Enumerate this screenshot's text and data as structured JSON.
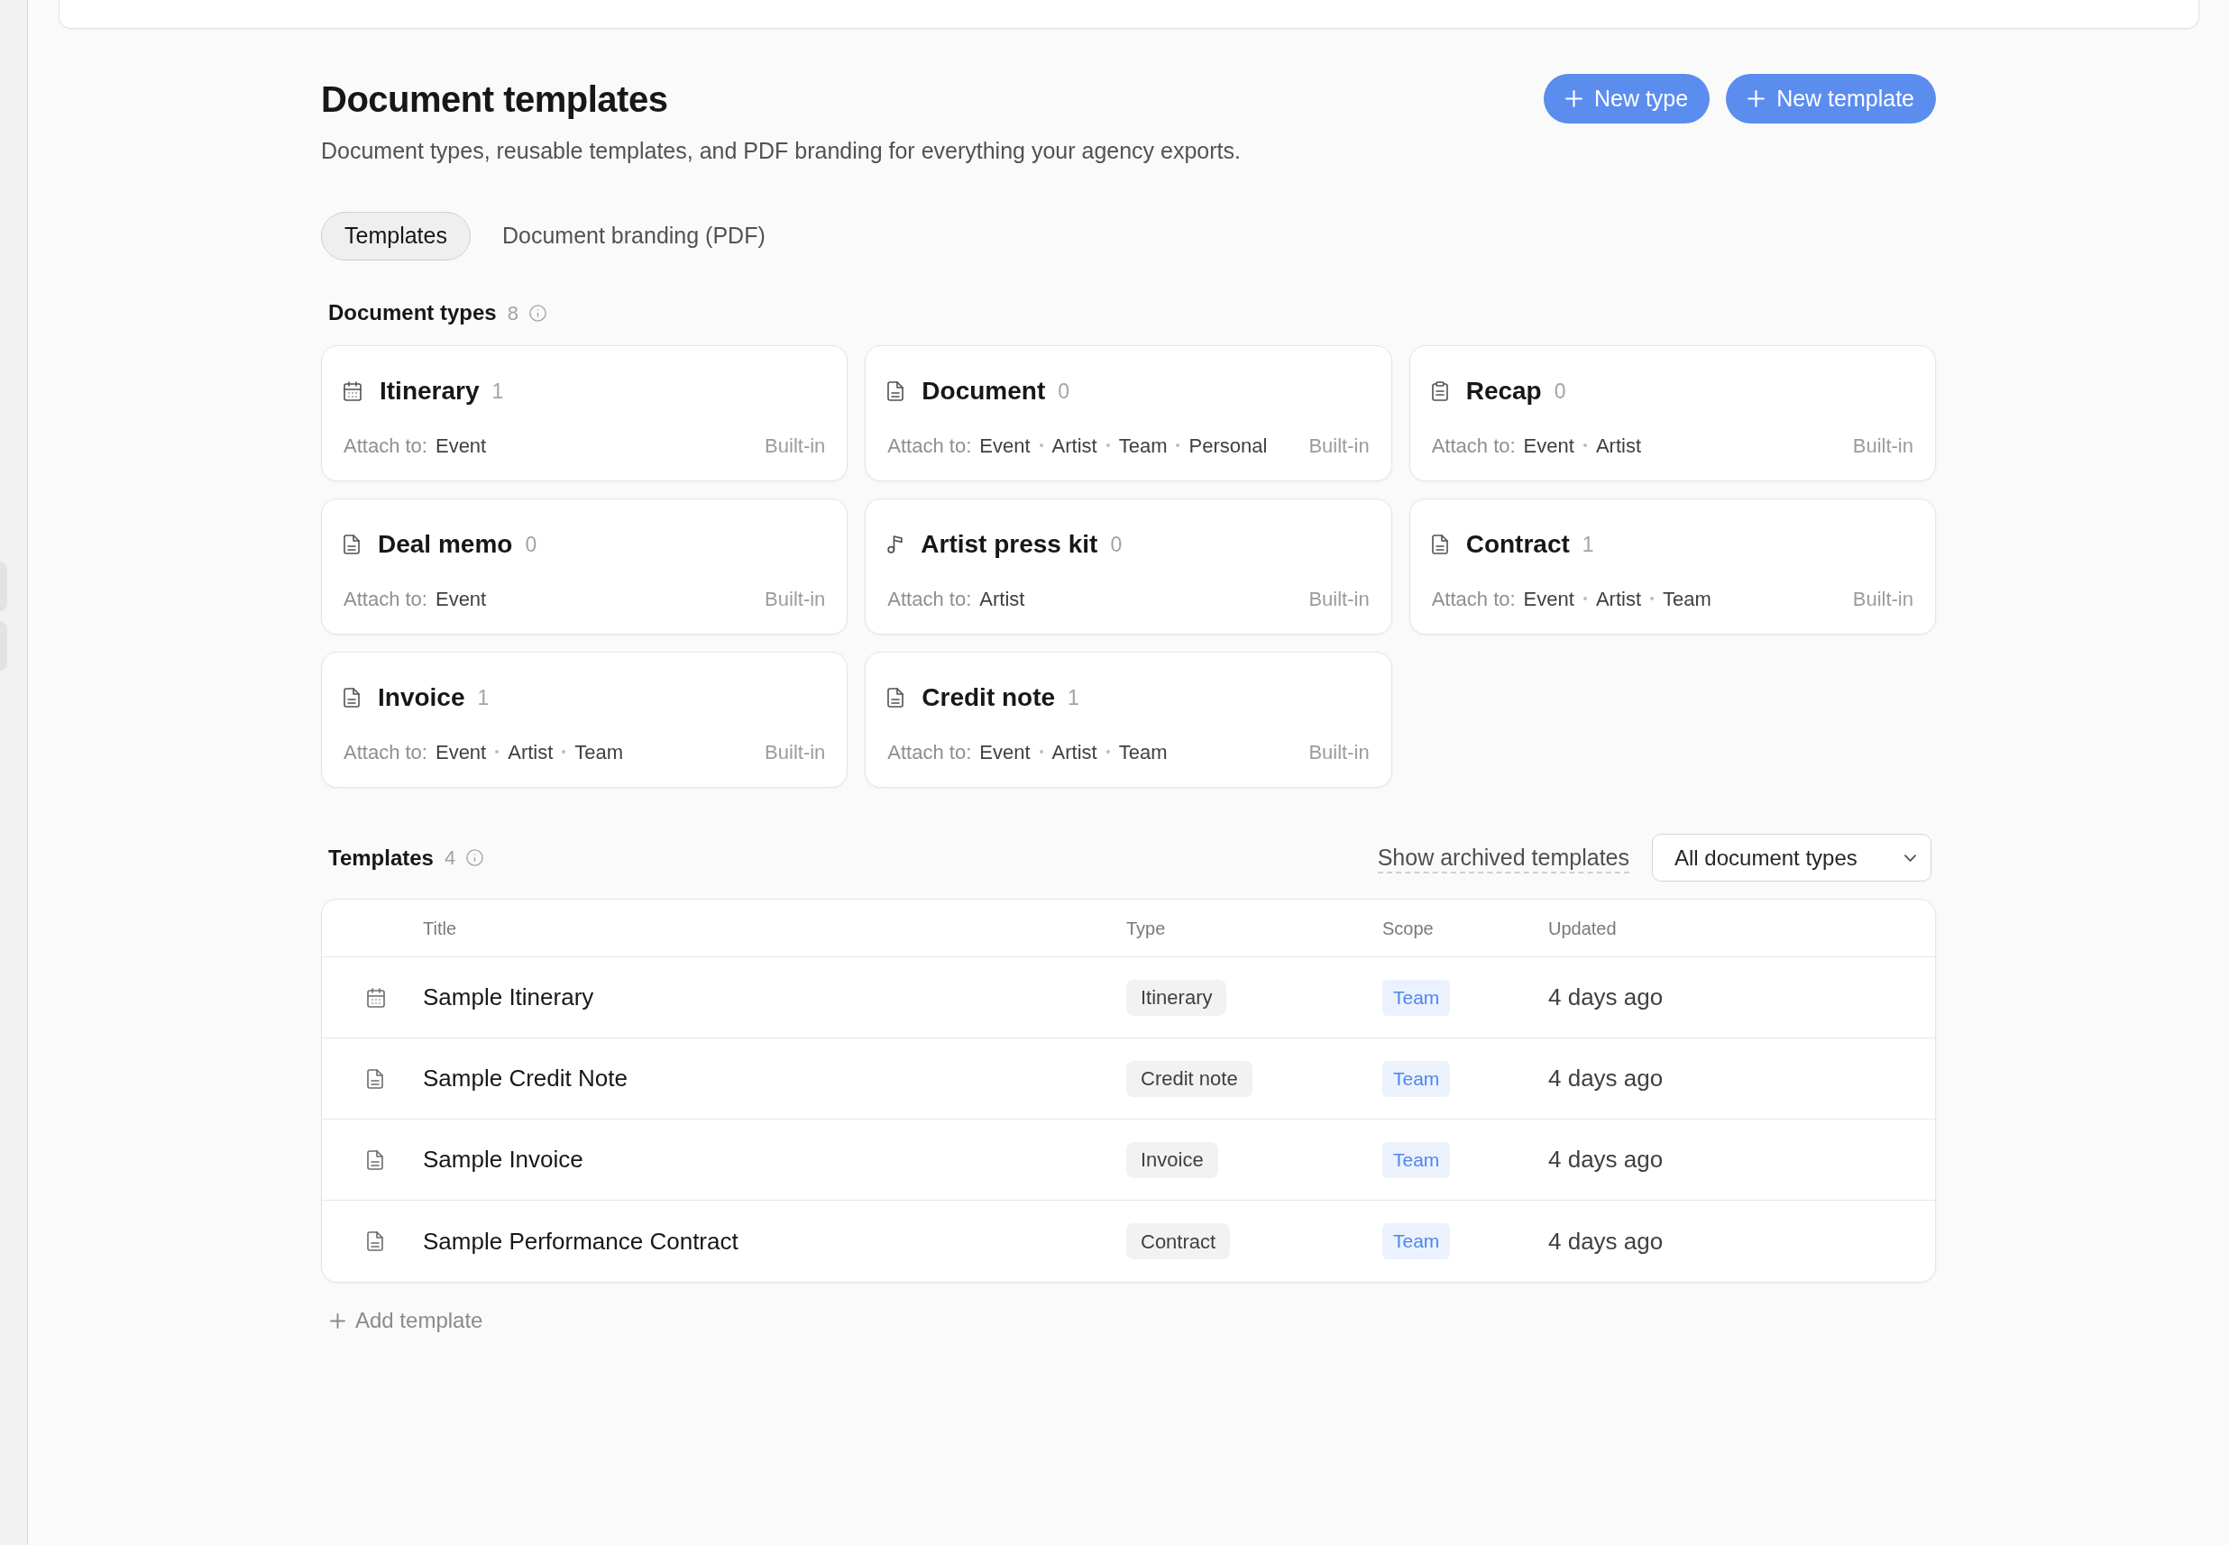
{
  "page": {
    "title": "Document templates",
    "subtitle": "Document types, reusable templates, and PDF branding for everything your agency exports."
  },
  "actions": [
    {
      "label": "New type"
    },
    {
      "label": "New template"
    }
  ],
  "tabs": [
    {
      "label": "Templates",
      "selected": true
    },
    {
      "label": "Document branding (PDF)",
      "selected": false
    }
  ],
  "document_types": {
    "heading": "Document types",
    "count": "8",
    "cards": [
      {
        "kind": "calendar",
        "name": "Itinerary",
        "count": "1",
        "attach_label": "Attach to:",
        "attach_to": [
          "Event"
        ],
        "tag": "Built-in"
      },
      {
        "kind": "document",
        "name": "Document",
        "count": "0",
        "attach_label": "Attach to:",
        "attach_to": [
          "Event",
          "Artist",
          "Team",
          "Personal"
        ],
        "tag": "Built-in"
      },
      {
        "kind": "clipboard",
        "name": "Recap",
        "count": "0",
        "attach_label": "Attach to:",
        "attach_to": [
          "Event",
          "Artist"
        ],
        "tag": "Built-in"
      },
      {
        "kind": "document",
        "name": "Deal memo",
        "count": "0",
        "attach_label": "Attach to:",
        "attach_to": [
          "Event"
        ],
        "tag": "Built-in"
      },
      {
        "kind": "music",
        "name": "Artist press kit",
        "count": "0",
        "attach_label": "Attach to:",
        "attach_to": [
          "Artist"
        ],
        "tag": "Built-in"
      },
      {
        "kind": "document",
        "name": "Contract",
        "count": "1",
        "attach_label": "Attach to:",
        "attach_to": [
          "Event",
          "Artist",
          "Team"
        ],
        "tag": "Built-in"
      },
      {
        "kind": "document",
        "name": "Invoice",
        "count": "1",
        "attach_label": "Attach to:",
        "attach_to": [
          "Event",
          "Artist",
          "Team"
        ],
        "tag": "Built-in"
      },
      {
        "kind": "document",
        "name": "Credit note",
        "count": "1",
        "attach_label": "Attach to:",
        "attach_to": [
          "Event",
          "Artist",
          "Team"
        ],
        "tag": "Built-in"
      }
    ]
  },
  "templates": {
    "heading": "Templates",
    "count": "4",
    "archived_link": "Show archived templates",
    "type_filter": {
      "value": "All document types"
    },
    "columns": [
      "Title",
      "Type",
      "Scope",
      "Updated"
    ],
    "rows": [
      {
        "kind": "calendar",
        "title": "Sample Itinerary",
        "type": "Itinerary",
        "scope": "Team",
        "updated": "4 days ago"
      },
      {
        "kind": "document",
        "title": "Sample Credit Note",
        "type": "Credit note",
        "scope": "Team",
        "updated": "4 days ago"
      },
      {
        "kind": "document",
        "title": "Sample Invoice",
        "type": "Invoice",
        "scope": "Team",
        "updated": "4 days ago"
      },
      {
        "kind": "document",
        "title": "Sample Performance Contract",
        "type": "Contract",
        "scope": "Team",
        "updated": "4 days ago"
      }
    ],
    "add_button": {
      "label": "Add template"
    }
  }
}
